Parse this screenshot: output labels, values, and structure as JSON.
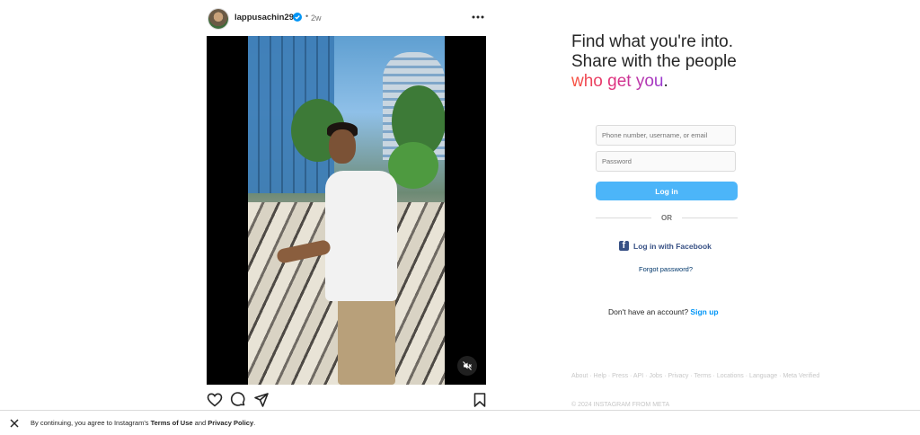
{
  "post": {
    "username": "lappusachin295",
    "dot": "•",
    "age": "2w"
  },
  "tagline": {
    "line1": "Find what you're into.",
    "line2": "Share with the people",
    "line3_highlight": "who get you",
    "line3_end": "."
  },
  "login": {
    "username_placeholder": "Phone number, username, or email",
    "password_placeholder": "Password",
    "login_label": "Log in",
    "or_label": "OR",
    "facebook_label": "Log in with Facebook",
    "forgot_label": "Forgot password?",
    "no_account_text": "Don't have an account?",
    "signup_label": "Sign up"
  },
  "footer": {
    "links": [
      "About",
      "Help",
      "Press",
      "API",
      "Jobs",
      "Privacy",
      "Terms",
      "Locations",
      "Language",
      "Meta Verified"
    ],
    "separator": " · ",
    "copyright": "© 2024 INSTAGRAM FROM META"
  },
  "terms_bar": {
    "prefix": "By continuing, you agree to Instagram's ",
    "terms_link": "Terms of Use",
    "middle": " and ",
    "privacy_link": "Privacy Policy",
    "suffix": "."
  },
  "colors": {
    "accent_blue": "#4cb5f9",
    "link_blue": "#0095f6",
    "facebook_blue": "#385185",
    "verified_blue": "#0095f6"
  },
  "icons": [
    "verified-badge-icon",
    "more-options-icon",
    "mute-icon",
    "heart-icon",
    "comment-icon",
    "share-icon",
    "bookmark-icon",
    "facebook-icon",
    "close-icon"
  ]
}
